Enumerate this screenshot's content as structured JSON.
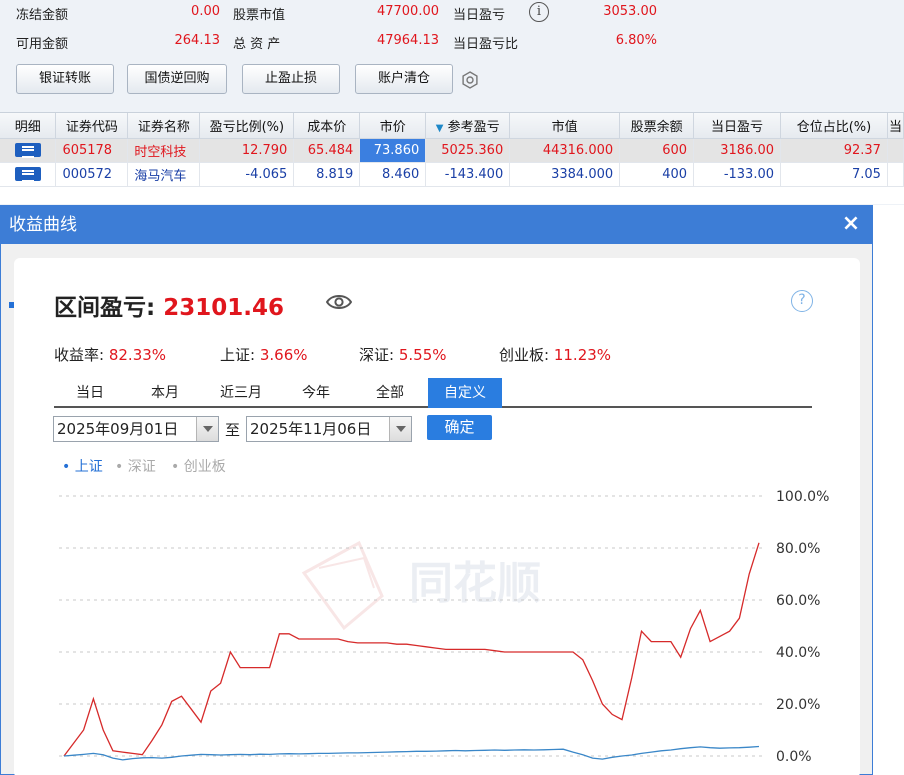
{
  "summary": {
    "frozen_label": "冻结金额",
    "frozen_value": "0.00",
    "stock_value_label": "股票市值",
    "stock_value": "47700.00",
    "today_pnl_label": "当日盈亏",
    "today_pnl_value": "3053.00",
    "available_label": "可用金额",
    "available_value": "264.13",
    "total_assets_label": "总 资 产",
    "total_assets_value": "47964.13",
    "today_pnl_ratio_label": "当日盈亏比",
    "today_pnl_ratio_value": "6.80%"
  },
  "toolbar": {
    "transfer": "银证转账",
    "repo": "国债逆回购",
    "stop": "止盈止损",
    "clear": "账户清仓"
  },
  "table": {
    "headers": [
      "明细",
      "证券代码",
      "证券名称",
      "盈亏比例(%)",
      "成本价",
      "市价",
      "参考盈亏",
      "市值",
      "股票余额",
      "当日盈亏",
      "仓位占比(%)",
      "当"
    ],
    "rows": [
      [
        "",
        "605178",
        "时空科技",
        "12.790",
        "65.484",
        "73.860",
        "5025.360",
        "44316.000",
        "600",
        "3186.00",
        "92.37"
      ],
      [
        "",
        "000572",
        "海马汽车",
        "-4.065",
        "8.819",
        "8.460",
        "-143.400",
        "3384.000",
        "400",
        "-133.00",
        "7.05"
      ]
    ]
  },
  "dialog": {
    "title": "收益曲线",
    "close": "×",
    "pnl_label": "区间盈亏:",
    "pnl_value": "23101.46",
    "help": "?",
    "metrics": [
      {
        "label": "收益率:",
        "value": "82.33%"
      },
      {
        "label": "上证:",
        "value": "3.66%"
      },
      {
        "label": "深证:",
        "value": "5.55%"
      },
      {
        "label": "创业板:",
        "value": "11.23%"
      }
    ],
    "tabs": [
      "当日",
      "本月",
      "近三月",
      "今年",
      "全部",
      "自定义"
    ],
    "active_tab": "自定义",
    "start_date": "2025年09月01日",
    "to": "至",
    "end_date": "2025年11月06日",
    "confirm": "确定",
    "legends": [
      "• 上证",
      "• 深证",
      "• 创业板"
    ],
    "watermark": "同花顺"
  },
  "chart_data": {
    "type": "line",
    "y_ticks": [
      "100.0%",
      "80.0%",
      "60.0%",
      "40.0%",
      "20.0%",
      "0.0%"
    ],
    "ylim": [
      0,
      100
    ],
    "grid": true,
    "colors": {
      "portfolio": "#d62a2a",
      "index": "#3a87c8"
    },
    "series": [
      {
        "key": "portfolio",
        "values": [
          0,
          5,
          10,
          22,
          10,
          2,
          1.5,
          1,
          0.5,
          6,
          12,
          21,
          23,
          18,
          13,
          25,
          28,
          40,
          34,
          34,
          34,
          34,
          47,
          47,
          45,
          45,
          45,
          45,
          45,
          44,
          43.5,
          43.5,
          43.5,
          43.5,
          43,
          43,
          42.5,
          42,
          41.5,
          41,
          41,
          41,
          41,
          41,
          40.5,
          40,
          40,
          40,
          40,
          40,
          40,
          40,
          40,
          37,
          29,
          20,
          16,
          14,
          30,
          48,
          44,
          44,
          44,
          38,
          49,
          56,
          44,
          46,
          48,
          53,
          70,
          82
        ]
      },
      {
        "key": "上证",
        "values": [
          0,
          0.3,
          0.6,
          1,
          0.5,
          -0.8,
          -1.5,
          -1,
          -0.7,
          -0.6,
          -0.8,
          -0.5,
          0,
          0.3,
          0.6,
          0.5,
          0.4,
          0.5,
          0.6,
          0.5,
          0.7,
          0.6,
          0.8,
          0.9,
          0.8,
          0.9,
          1,
          1,
          1.1,
          1.2,
          1.2,
          1.3,
          1.4,
          1.5,
          1.6,
          1.7,
          1.8,
          1.8,
          1.9,
          2,
          2.1,
          2,
          2.1,
          2.2,
          2.3,
          2.2,
          2.3,
          2.4,
          2.3,
          2.4,
          2.5,
          2.6,
          1.5,
          0.5,
          -0.8,
          -1.2,
          -0.5,
          0,
          0.4,
          1,
          1.5,
          2,
          2.3,
          2.8,
          3.2,
          3.5,
          3.2,
          3,
          3.1,
          3.2,
          3.4,
          3.66
        ]
      }
    ]
  }
}
